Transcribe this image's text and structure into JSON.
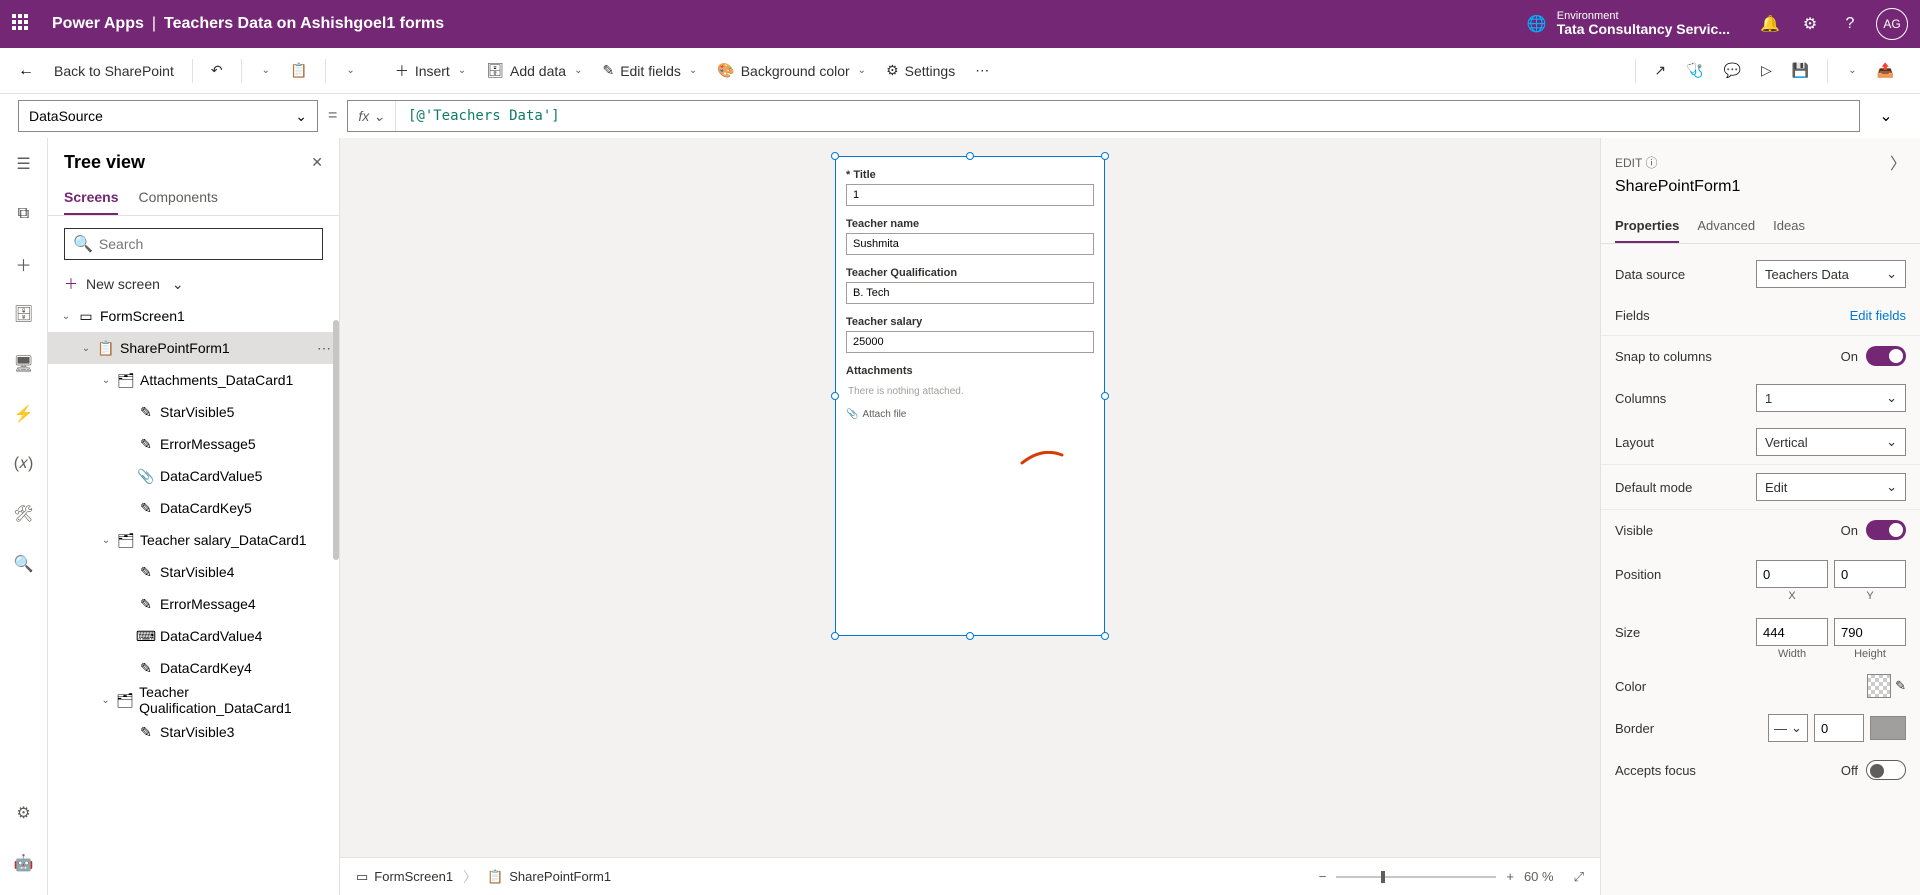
{
  "header": {
    "brand": "Power Apps",
    "doc_title": "Teachers Data on Ashishgoel1 forms",
    "env_label": "Environment",
    "env_value": "Tata Consultancy Servic...",
    "avatar": "AG"
  },
  "toolbar": {
    "back": "Back to SharePoint",
    "insert": "Insert",
    "add_data": "Add data",
    "edit_fields": "Edit fields",
    "bg_color": "Background color",
    "settings": "Settings"
  },
  "formula": {
    "property": "DataSource",
    "fx": "fx",
    "expression": "[@'Teachers Data']"
  },
  "tree": {
    "title": "Tree view",
    "tabs": {
      "screens": "Screens",
      "components": "Components"
    },
    "search_placeholder": "Search",
    "new_screen": "New screen",
    "items": [
      {
        "label": "FormScreen1",
        "depth": 0,
        "icon": "screen",
        "caret": true
      },
      {
        "label": "SharePointForm1",
        "depth": 1,
        "icon": "form",
        "caret": true,
        "selected": true,
        "more": true
      },
      {
        "label": "Attachments_DataCard1",
        "depth": 2,
        "icon": "card",
        "caret": true
      },
      {
        "label": "StarVisible5",
        "depth": 3,
        "icon": "label"
      },
      {
        "label": "ErrorMessage5",
        "depth": 3,
        "icon": "label"
      },
      {
        "label": "DataCardValue5",
        "depth": 3,
        "icon": "attach"
      },
      {
        "label": "DataCardKey5",
        "depth": 3,
        "icon": "label"
      },
      {
        "label": "Teacher salary_DataCard1",
        "depth": 2,
        "icon": "card",
        "caret": true
      },
      {
        "label": "StarVisible4",
        "depth": 3,
        "icon": "label"
      },
      {
        "label": "ErrorMessage4",
        "depth": 3,
        "icon": "label"
      },
      {
        "label": "DataCardValue4",
        "depth": 3,
        "icon": "input"
      },
      {
        "label": "DataCardKey4",
        "depth": 3,
        "icon": "label"
      },
      {
        "label": "Teacher Qualification_DataCard1",
        "depth": 2,
        "icon": "card",
        "caret": true
      },
      {
        "label": "StarVisible3",
        "depth": 3,
        "icon": "label"
      }
    ]
  },
  "form": {
    "fields": [
      {
        "label": "Title",
        "value": "1",
        "required": true
      },
      {
        "label": "Teacher name",
        "value": "Sushmita"
      },
      {
        "label": "Teacher Qualification",
        "value": "B. Tech"
      },
      {
        "label": "Teacher salary",
        "value": "25000"
      }
    ],
    "attachments_label": "Attachments",
    "attachments_empty": "There is nothing attached.",
    "attach_file": "Attach file"
  },
  "breadcrumb": {
    "item1": "FormScreen1",
    "item2": "SharePointForm1",
    "zoom": "60  %"
  },
  "props": {
    "edit": "EDIT",
    "name": "SharePointForm1",
    "tabs": {
      "properties": "Properties",
      "advanced": "Advanced",
      "ideas": "Ideas"
    },
    "data_source": {
      "label": "Data source",
      "value": "Teachers Data"
    },
    "fields": {
      "label": "Fields",
      "link": "Edit fields"
    },
    "snap": {
      "label": "Snap to columns",
      "state": "On"
    },
    "columns": {
      "label": "Columns",
      "value": "1"
    },
    "layout": {
      "label": "Layout",
      "value": "Vertical"
    },
    "default_mode": {
      "label": "Default mode",
      "value": "Edit"
    },
    "visible": {
      "label": "Visible",
      "state": "On"
    },
    "position": {
      "label": "Position",
      "x": "0",
      "y": "0",
      "xl": "X",
      "yl": "Y"
    },
    "size": {
      "label": "Size",
      "w": "444",
      "h": "790",
      "wl": "Width",
      "hl": "Height"
    },
    "color": {
      "label": "Color"
    },
    "border": {
      "label": "Border",
      "value": "0"
    },
    "accepts_focus": {
      "label": "Accepts focus",
      "state": "Off"
    }
  }
}
